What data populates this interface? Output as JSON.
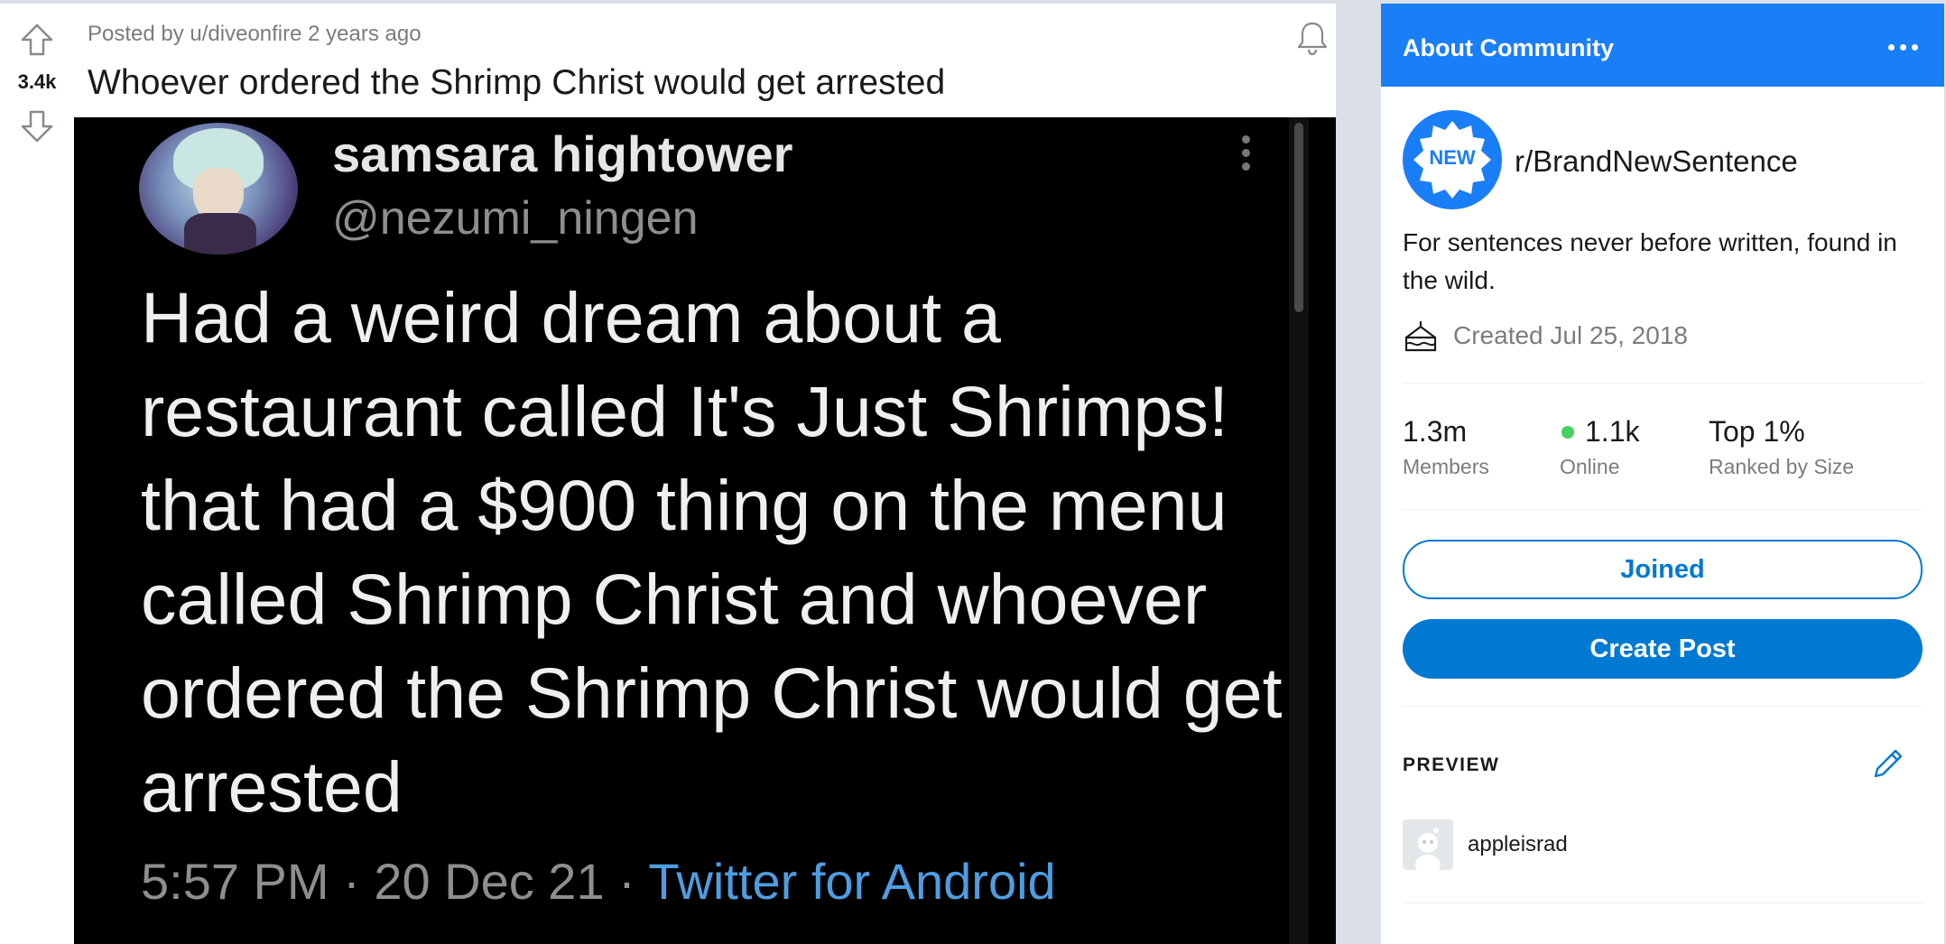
{
  "post": {
    "vote_count": "3.4k",
    "meta": "Posted by u/diveonfire 2 years ago",
    "title": "Whoever ordered the Shrimp Christ would get arrested",
    "tweet": {
      "name": "samsara hightower",
      "handle": "@nezumi_ningen",
      "text": "Had a weird dream about a restaurant called It's Just Shrimps! that had a $900 thing on the menu called Shrimp Christ and whoever ordered the Shrimp Christ would get arrested",
      "time": "5:57 PM · 20 Dec 21 · ",
      "client": "Twitter for Android"
    }
  },
  "sidebar": {
    "header_title": "About Community",
    "badge_text": "NEW",
    "sub_name": "r/BrandNewSentence",
    "description": "For sentences never before written, found in the wild.",
    "created": "Created Jul 25, 2018",
    "stats": [
      {
        "value": "1.3m",
        "label": "Members"
      },
      {
        "value": "1.1k",
        "label": "Online"
      },
      {
        "value": "Top 1%",
        "label": "Ranked by Size"
      }
    ],
    "joined_label": "Joined",
    "create_post_label": "Create Post",
    "preview_label": "PREVIEW",
    "preview_user": "appleisrad"
  },
  "colors": {
    "accent": "#1a7ef7",
    "button_blue": "#0079d3",
    "online": "#46d160",
    "tweet_link": "#4e9de0"
  },
  "icons": [
    "upvote-icon",
    "downvote-icon",
    "bell-icon",
    "more-icon",
    "cake-icon",
    "pencil-icon"
  ]
}
